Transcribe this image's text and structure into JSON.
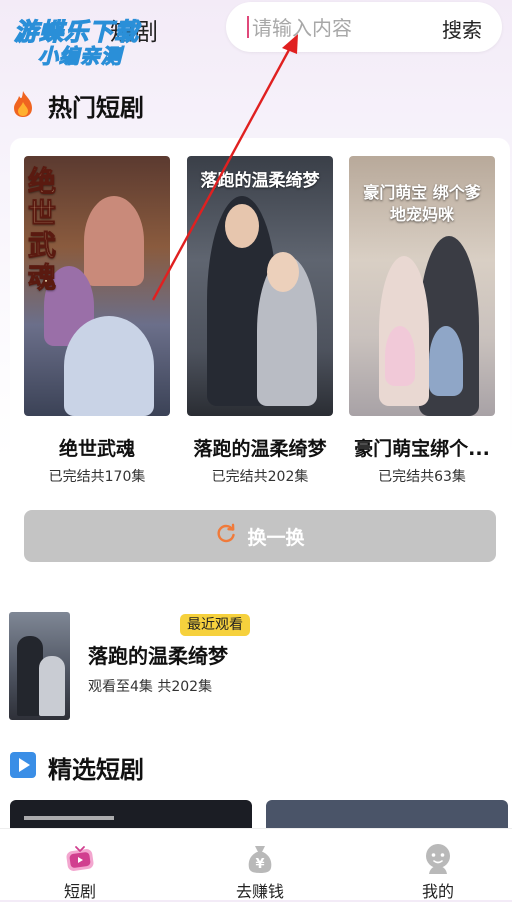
{
  "header": {
    "watermark_line1": "游蝶乐下载",
    "watermark_line2": "小编亲测",
    "hidden_tab_label": "短剧",
    "search_placeholder": "请输入内容",
    "search_button": "搜索"
  },
  "hot_section": {
    "title": "热门短剧",
    "dramas": [
      {
        "poster_text": "绝世武魂",
        "name": "绝世武魂",
        "meta": "已完结共170集"
      },
      {
        "poster_text": "落跑的温柔绮梦",
        "name": "落跑的温柔绮梦",
        "meta": "已完结共202集"
      },
      {
        "poster_text": "豪门萌宝 绑个爹地宠妈咪",
        "name": "豪门萌宝绑个...",
        "meta": "已完结共63集"
      }
    ],
    "refresh_label": "换一换"
  },
  "recent": {
    "badge": "最近观看",
    "title": "落跑的温柔绮梦",
    "meta": "观看至4集 共202集"
  },
  "featured_section": {
    "title": "精选短剧"
  },
  "bottom_nav": [
    {
      "label": "短剧",
      "icon": "tv-icon"
    },
    {
      "label": "去赚钱",
      "icon": "money-bag-icon"
    },
    {
      "label": "我的",
      "icon": "profile-icon"
    }
  ],
  "colors": {
    "refresh_bg": "#c4c4c4",
    "badge_bg": "#f6d13d",
    "annotation_red": "#e02020",
    "accent_pink": "#e0487a"
  }
}
